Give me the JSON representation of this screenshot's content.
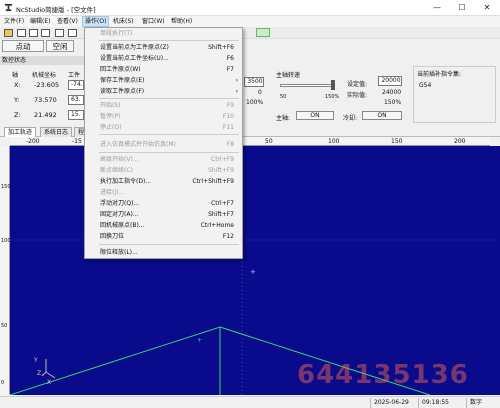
{
  "window": {
    "title": "NcStudio简捷版 - [空文件]",
    "minimize": "—",
    "maximize": "☐",
    "close": "✕"
  },
  "menu": [
    "文件(F)",
    "编辑(E)",
    "查看(V)",
    "操作(O)",
    "机床(S)",
    "窗口(W)",
    "帮助(H)"
  ],
  "modes": [
    "点动",
    "空闲"
  ],
  "status_panel": {
    "title": "数控状态",
    "axis_header": "轴",
    "machine_header": "机械坐标",
    "work_header": "工件",
    "rows": [
      {
        "axis": "X:",
        "machine": "-23.605",
        "work": "-74."
      },
      {
        "axis": "Y:",
        "machine": "73.570",
        "work": "63."
      },
      {
        "axis": "Z:",
        "machine": "21.492",
        "work": "15."
      }
    ]
  },
  "feed": {
    "value": "3500",
    "actual": "0",
    "percent": "100%"
  },
  "spindle": {
    "title": "主轴转速",
    "scale_min": "50",
    "scale_max": "150%",
    "set_label": "设定值:",
    "set_value": "20000",
    "actual_label": "实际值:",
    "actual_value": "24000",
    "percent": "150%",
    "spindle_label": "主轴:",
    "spindle_btn": "ON",
    "coolant_label": "冷却:",
    "coolant_btn": "ON"
  },
  "modal": {
    "title": "当前插补指令集:",
    "value": "G54"
  },
  "tabs": [
    "加工轨迹",
    "系统日志",
    "程"
  ],
  "ruler_h": [
    "-200",
    "-15",
    "50",
    "100",
    "150",
    "200"
  ],
  "ruler_v": [
    "150",
    "100",
    "50",
    "0"
  ],
  "axes_label": {
    "y": "Y",
    "z": "Z",
    "x": "X"
  },
  "dropdown": [
    {
      "label": "单段执行(T)",
      "shortcut": "",
      "disabled": true
    },
    {
      "sep": true
    },
    {
      "label": "设置当前点为工件原点(Z)",
      "shortcut": "Shift+F6",
      "disabled": false
    },
    {
      "label": "设置当前点工件坐标(U)...",
      "shortcut": "F6",
      "disabled": false
    },
    {
      "label": "回工件原点(W)",
      "shortcut": "F7",
      "disabled": false
    },
    {
      "label": "保存工件原点(E)",
      "shortcut": "",
      "arrow": true,
      "disabled": false
    },
    {
      "label": "读取工件原点(F)",
      "shortcut": "",
      "arrow": true,
      "disabled": false
    },
    {
      "sep": true
    },
    {
      "label": "开始(S)",
      "shortcut": "F9",
      "disabled": true
    },
    {
      "label": "暂停(P)",
      "shortcut": "F10",
      "disabled": true
    },
    {
      "label": "停止(O)",
      "shortcut": "F11",
      "disabled": true
    },
    {
      "sep": true
    },
    {
      "label": "进入仿真模式并开始仿真(M)",
      "shortcut": "F8",
      "disabled": true
    },
    {
      "sep": true
    },
    {
      "label": "高级开始(V)...",
      "shortcut": "Ctrl+F9",
      "disabled": true
    },
    {
      "label": "断点继续(C)",
      "shortcut": "Shift+F9",
      "disabled": true
    },
    {
      "label": "执行加工指令(D)...",
      "shortcut": "Ctrl+Shift+F9",
      "disabled": false
    },
    {
      "label": "进给(J)...",
      "shortcut": "",
      "disabled": true
    },
    {
      "label": "浮动对刀(Q)...",
      "shortcut": "Ctrl+F7",
      "disabled": false
    },
    {
      "label": "固定对刀(A)...",
      "shortcut": "Shift+F7",
      "disabled": false
    },
    {
      "label": "回机械原点(B)...",
      "shortcut": "Ctrl+Home",
      "disabled": false
    },
    {
      "label": "回换刀位",
      "shortcut": "F12",
      "disabled": false
    },
    {
      "sep": true
    },
    {
      "label": "限位释放(L)...",
      "shortcut": "",
      "disabled": false
    }
  ],
  "statusbar": {
    "date": "2025-06-29",
    "time": "09:18:55",
    "mode": "数字"
  },
  "watermark": "644135136",
  "colors": {
    "canvas": "#0a0a8c",
    "path": "#39d46b",
    "highlight": "#cde4f7"
  }
}
